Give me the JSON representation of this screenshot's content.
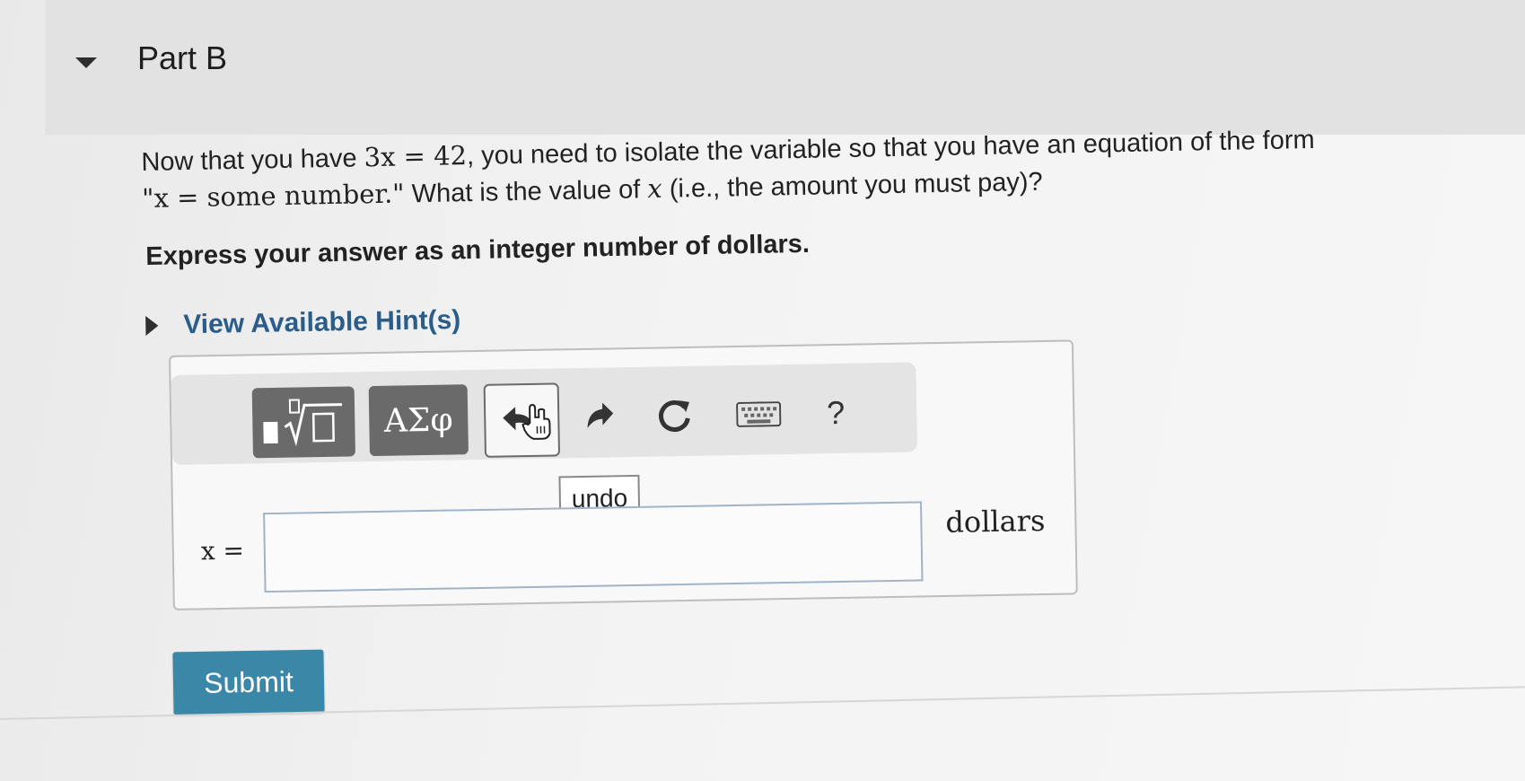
{
  "part": {
    "title": "Part B"
  },
  "question": {
    "t1": "Now that you have ",
    "eq1": "3x = 42",
    "t2": ", you need to isolate the variable so that you have an equation of the form",
    "eq2": "\"x = some number.\"",
    "t3": " What is the value of ",
    "var": "x",
    "t4": " (i.e., the amount you must pay)?"
  },
  "instruction": "Express your answer as an integer number of dollars.",
  "hint": {
    "label": "View Available Hint(s)"
  },
  "toolbar": {
    "greek_label": "ΑΣφ",
    "help_label": "?",
    "tooltip": "undo"
  },
  "answer": {
    "variable_label": "x =",
    "unit": "dollars",
    "value": ""
  },
  "submit": {
    "label": "Submit"
  },
  "colors": {
    "submit": "#3a87a7",
    "hint_link": "#2a5d8a",
    "toolbar_dark": "#6a6a6a"
  }
}
